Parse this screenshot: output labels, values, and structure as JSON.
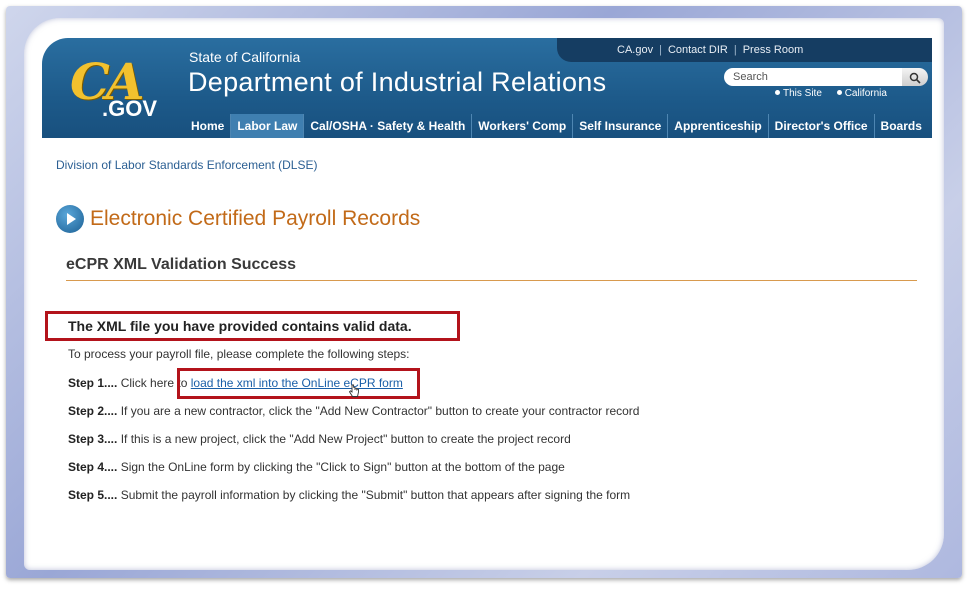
{
  "utility_links": [
    "CA.gov",
    "Contact DIR",
    "Press Room"
  ],
  "header": {
    "logo_ca": "CA",
    "logo_gov": ".GOV",
    "subtitle": "State of California",
    "title": "Department of Industrial Relations"
  },
  "search": {
    "placeholder": "Search",
    "button_icon": "magnifier-icon",
    "scope_options": [
      "This Site",
      "California"
    ]
  },
  "nav": {
    "items": [
      "Home",
      "Labor Law",
      "Cal/OSHA · Safety & Health",
      "Workers' Comp",
      "Self Insurance",
      "Apprenticeship",
      "Director's Office",
      "Boards"
    ],
    "active": "Labor Law"
  },
  "breadcrumb": "Division of Labor Standards Enforcement (DLSE)",
  "page_title": "Electronic Certified Payroll Records",
  "section_title": "eCPR XML Validation Success",
  "valid_message": "The XML file you have provided contains valid data.",
  "intro": "To process your payroll file, please complete the following steps:",
  "steps": [
    {
      "label": "Step 1....",
      "text": "Click here to ",
      "link": "load the xml into the OnLine eCPR form"
    },
    {
      "label": "Step 2....",
      "text": "If you are a new contractor, click the \"Add New Contractor\" button to create your contractor record"
    },
    {
      "label": "Step 3....",
      "text": "If this is a new project, click the \"Add New Project\" button to create the project record"
    },
    {
      "label": "Step 4....",
      "text": "Sign the OnLine form by clicking the \"Click to Sign\" button at the bottom of the page"
    },
    {
      "label": "Step 5....",
      "text": "Submit the payroll information by clicking the \"Submit\" button that appears after signing the form"
    }
  ],
  "colors": {
    "header_blue": "#1d5a8a",
    "title_orange": "#c26a18",
    "link_blue": "#1a5fa8",
    "highlight_red": "#b3131b"
  }
}
